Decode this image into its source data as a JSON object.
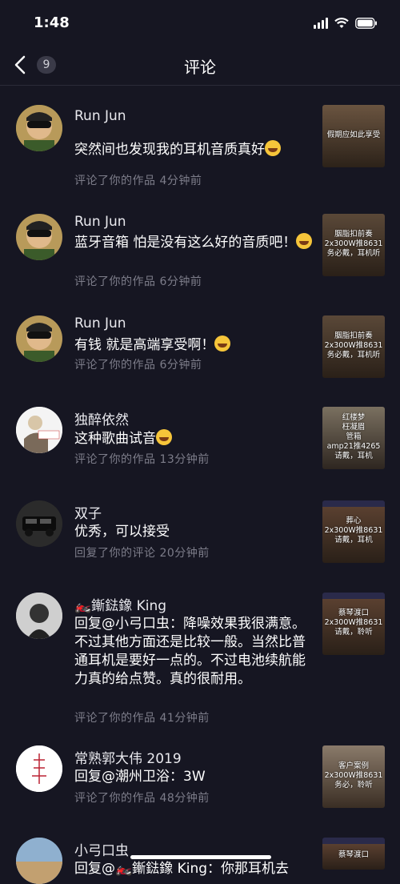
{
  "status": {
    "time": "1:48"
  },
  "nav": {
    "badge": "9",
    "title": "评论"
  },
  "items": [
    {
      "name": "Run  Jun",
      "text": "突然间也发现我的耳机音质真好",
      "meta": "评论了你的作品  4分钟前",
      "thumb": "假期应如此享受"
    },
    {
      "name": "Run  Jun",
      "text": "蓝牙音箱 怕是没有这么好的音质吧！",
      "meta": "评论了你的作品  6分钟前",
      "thumb": "胭脂扣前奏\n2x300W推8631\n务必戴，耳机听"
    },
    {
      "name": "Run  Jun",
      "text": "有钱 就是高端享受啊！",
      "meta": "评论了你的作品  6分钟前",
      "thumb": "胭脂扣前奏\n2x300W推8631\n务必戴，耳机听"
    },
    {
      "name": "独醉依然",
      "text": "这种歌曲试音",
      "meta": "评论了你的作品  13分钟前",
      "thumb": "红楼梦\n枉凝眉\n管箱\namp21推4265\n请戴，耳机"
    },
    {
      "name": "双子",
      "text": "优秀，可以接受",
      "meta": "回复了你的评论  20分钟前",
      "thumb": "葬心\n2x300W推8631\n请戴，耳机"
    },
    {
      "name": "🏍️鏩鍅鐌 King",
      "text": "回复@小弓口虫：降噪效果我很满意。不过其他方面还是比较一般。当然比普通耳机是要好一点的。不过电池续航能力真的给点赞。真的很耐用。",
      "meta": "评论了你的作品  41分钟前",
      "thumb": "蔡琴渡口\n2x300W推8631\n请戴，聆听"
    },
    {
      "name": "常熟郭大伟 2019",
      "text": "回复@潮州卫浴：3W",
      "meta": "评论了你的作品  48分钟前",
      "thumb": "客户案例\n2x300W推8631\n务必，聆听"
    },
    {
      "name": "小弓口虫",
      "text": "回复@🏍️鏩鍅鐌 King：你那耳机去",
      "meta": "",
      "thumb": "蔡琴渡口"
    }
  ]
}
